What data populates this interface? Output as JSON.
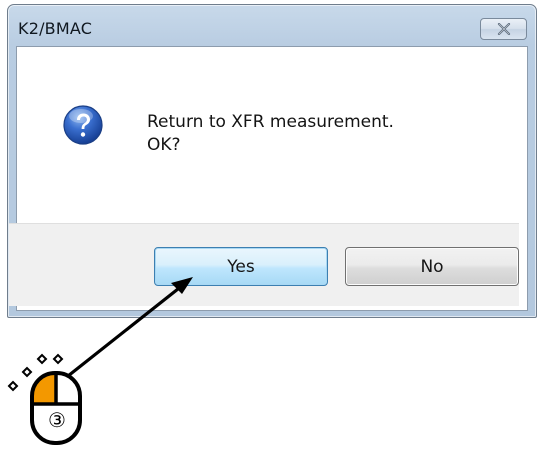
{
  "dialog": {
    "title": "K2/BMAC",
    "message_line1": "Return to XFR measurement.",
    "message_line2": "OK?",
    "icon": "question-icon",
    "close_icon": "close-icon",
    "buttons": {
      "yes_label": "Yes",
      "no_label": "No"
    }
  },
  "annotation": {
    "step_label": "③",
    "mouse_icon": "mouse-left-click-icon",
    "highlight_color": "#f39800",
    "arrow_color": "#000000"
  }
}
